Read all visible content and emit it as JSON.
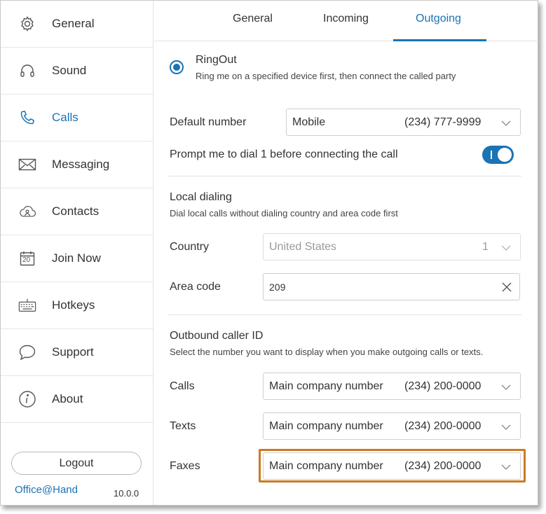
{
  "sidebar": {
    "items": [
      {
        "label": "General",
        "icon": "gear-icon"
      },
      {
        "label": "Sound",
        "icon": "headphones-icon"
      },
      {
        "label": "Calls",
        "icon": "phone-icon"
      },
      {
        "label": "Messaging",
        "icon": "envelope-icon"
      },
      {
        "label": "Contacts",
        "icon": "cloud-contacts-icon"
      },
      {
        "label": "Join Now",
        "icon": "calendar-icon",
        "icon_text": "20"
      },
      {
        "label": "Hotkeys",
        "icon": "keyboard-icon"
      },
      {
        "label": "Support",
        "icon": "chat-bubble-icon"
      },
      {
        "label": "About",
        "icon": "info-icon"
      }
    ],
    "active": "Calls",
    "logout_label": "Logout",
    "brand": "Office@Hand",
    "version": "10.0.0"
  },
  "tabs": [
    {
      "label": "General"
    },
    {
      "label": "Incoming"
    },
    {
      "label": "Outgoing"
    }
  ],
  "active_tab": "Outgoing",
  "ringout": {
    "title": "RingOut",
    "description": "Ring me on a specified device first, then connect the called party",
    "selected": true
  },
  "default_number": {
    "label": "Default number",
    "value": "Mobile",
    "number": "(234) 777-9999"
  },
  "prompt_dial": {
    "label": "Prompt me to dial 1 before connecting the call",
    "enabled": true
  },
  "local_dialing": {
    "title": "Local dialing",
    "description": "Dial local calls without dialing country and area code first",
    "country_label": "Country",
    "country_value": "United States",
    "country_code": "1",
    "area_code_label": "Area code",
    "area_code_value": "209"
  },
  "caller_id": {
    "title": "Outbound caller ID",
    "description": "Select the number you want to display when you make outgoing calls or texts.",
    "rows": [
      {
        "label": "Calls",
        "value": "Main company number",
        "number": "(234) 200-0000"
      },
      {
        "label": "Texts",
        "value": "Main company number",
        "number": "(234) 200-0000"
      },
      {
        "label": "Faxes",
        "value": "Main company number",
        "number": "(234) 200-0000"
      }
    ]
  },
  "colors": {
    "accent": "#1a73b4",
    "highlight": "#cc7a22"
  }
}
